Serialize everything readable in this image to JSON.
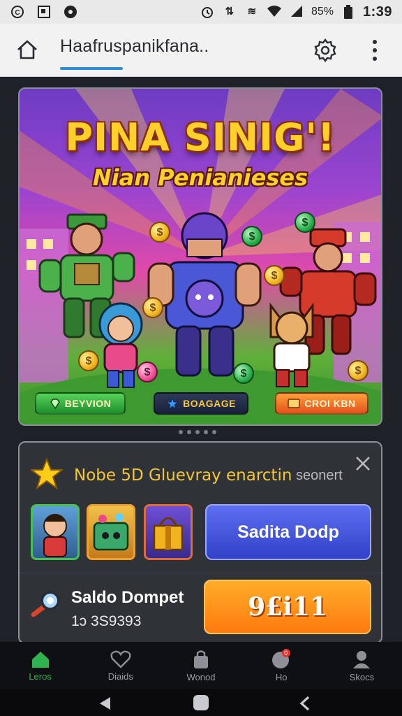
{
  "status_bar": {
    "time": "1:39",
    "battery": "85%",
    "left_icons": [
      "signal-c-icon",
      "screenshot-icon",
      "notification-dot-icon"
    ],
    "right_icons": [
      "alarm-icon",
      "data-icon",
      "vibrate-icon",
      "wifi-icon",
      "signal-icon",
      "battery-icon"
    ]
  },
  "app_bar": {
    "title": "Haafruspanikfana..",
    "icons": [
      "home-icon",
      "gear-icon",
      "more-vertical-icon"
    ]
  },
  "banner": {
    "title": "PINA SINIG'!",
    "subtitle": "Nian Penianieses",
    "buttons": [
      {
        "label": "BEYVION",
        "icon": "gem-icon",
        "color": "#2f9f3a"
      },
      {
        "label": "BOAGAGE",
        "icon": "star-icon",
        "color": "#1c2440"
      },
      {
        "label": "CROI KBN",
        "icon": "ticket-icon",
        "color": "#f06a22"
      }
    ],
    "carousel_page": 1,
    "carousel_total": 5
  },
  "promo": {
    "title": "Nobe 5D Gluevray enarctin",
    "secondary_text": "seonert",
    "action_button": "Sadita Dodp",
    "thumbnails": [
      "character-thumbnail",
      "chest-thumbnail",
      "gift-box-thumbnail"
    ],
    "wallet_label": "Saldo Dompet",
    "wallet_value": "1ɔ 3S9393",
    "wallet_button": "9£i11"
  },
  "bottom_nav": {
    "items": [
      {
        "label": "Leros",
        "icon": "home-icon",
        "active": true
      },
      {
        "label": "Diaids",
        "icon": "heart-icon",
        "active": false
      },
      {
        "label": "Wonod",
        "icon": "bag-icon",
        "active": false
      },
      {
        "label": "Ho",
        "icon": "chat-icon",
        "active": false,
        "badge": "0"
      },
      {
        "label": "Skocs",
        "icon": "person-icon",
        "active": false
      }
    ]
  },
  "colors": {
    "accent": "#2b8fd6",
    "active_nav": "#2fb34e",
    "promo_title": "#f4c638",
    "blue_button": "#3f52dc",
    "orange_button": "#ff8c18"
  }
}
